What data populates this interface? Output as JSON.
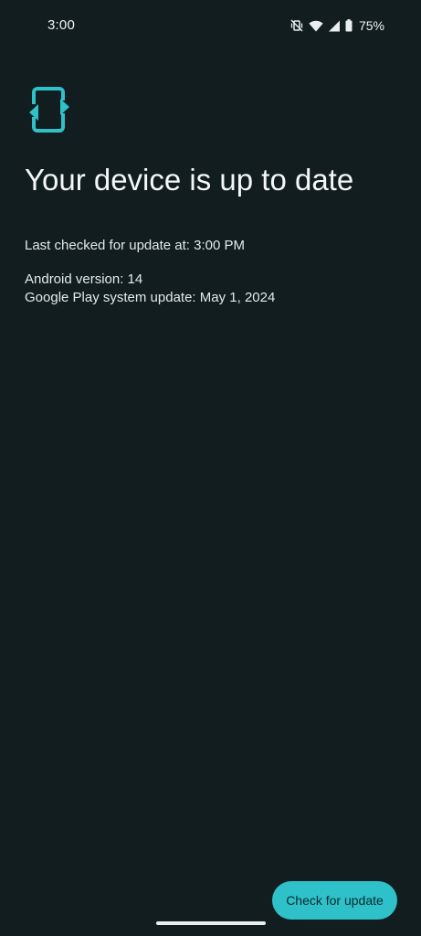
{
  "status_bar": {
    "time": "3:00",
    "icons": [
      "vibrate-off-icon",
      "wifi-icon",
      "signal-icon",
      "battery-icon"
    ],
    "battery_percent": "75%"
  },
  "main": {
    "icon": "system-update-icon",
    "title": "Your device is up to date",
    "last_checked": "Last checked for update at: 3:00 PM",
    "android_version": "Android version: 14",
    "play_system_update": "Google Play system update: May 1, 2024"
  },
  "actions": {
    "check_button_label": "Check for update"
  },
  "colors": {
    "background": "#111d1e",
    "accent": "#2ec1c9",
    "text": "#e6eeee"
  }
}
